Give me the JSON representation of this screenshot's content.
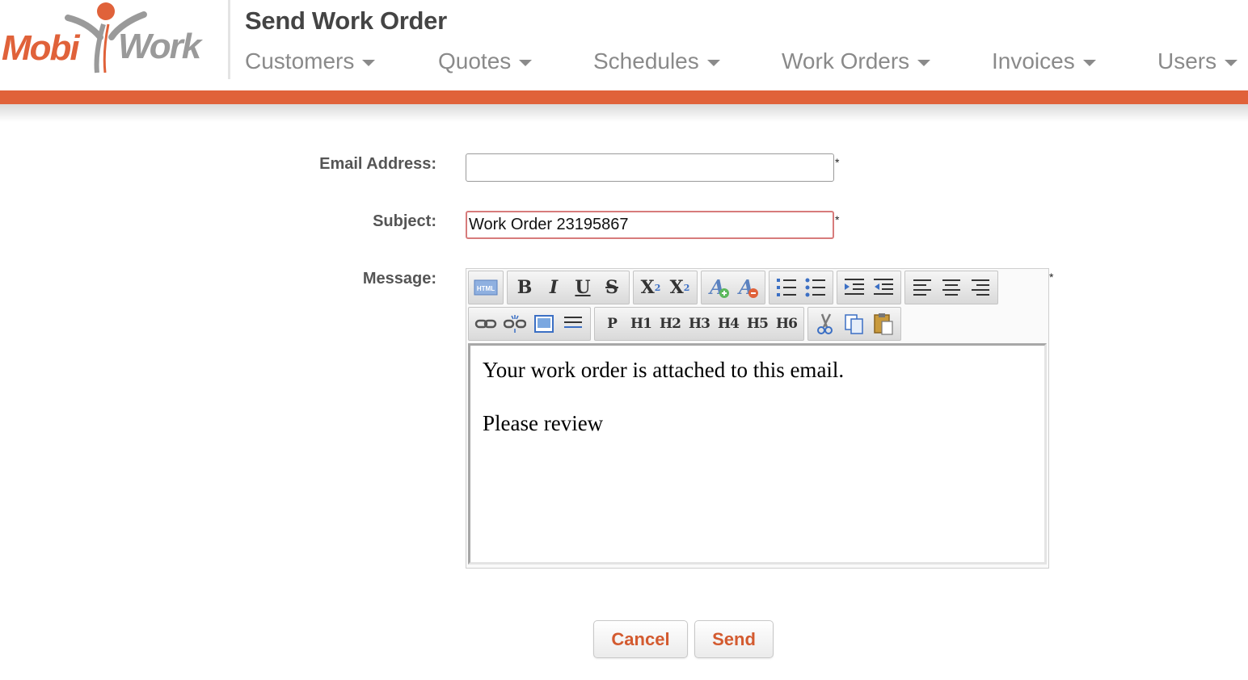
{
  "brand": {
    "logo_text_1": "Mobi",
    "logo_text_2": "Work",
    "accent_color": "#e0623a"
  },
  "header": {
    "title": "Send Work Order"
  },
  "nav": {
    "items": [
      {
        "label": "Customers"
      },
      {
        "label": "Quotes"
      },
      {
        "label": "Schedules"
      },
      {
        "label": "Work Orders"
      },
      {
        "label": "Invoices"
      },
      {
        "label": "Users"
      }
    ]
  },
  "form": {
    "email": {
      "label": "Email Address:",
      "value": "",
      "required_mark": "*"
    },
    "subject": {
      "label": "Subject:",
      "value": "Work Order 23195867",
      "required_mark": "*"
    },
    "message": {
      "label": "Message:",
      "required_mark": "*",
      "lines": [
        "Your work order is attached to this email.",
        "Please review"
      ]
    }
  },
  "toolbar": {
    "html_label": "HTML",
    "bold": "B",
    "italic": "I",
    "underline": "U",
    "strike": "S",
    "subscript": "X",
    "subscript_mark": "2",
    "superscript": "X",
    "superscript_mark": "2",
    "font_color_increase": "A",
    "font_color_decrease": "A",
    "paragraph": "P",
    "h1": "H1",
    "h2": "H2",
    "h3": "H3",
    "h4": "H4",
    "h5": "H5",
    "h6": "H6",
    "icons": [
      "html-icon",
      "bold-icon",
      "italic-icon",
      "underline-icon",
      "strikethrough-icon",
      "subscript-icon",
      "superscript-icon",
      "increase-font-icon",
      "decrease-font-icon",
      "ordered-list-icon",
      "unordered-list-icon",
      "indent-icon",
      "outdent-icon",
      "align-left-icon",
      "align-center-icon",
      "align-right-icon",
      "link-icon",
      "unlink-icon",
      "image-icon",
      "horizontal-rule-icon",
      "cut-icon",
      "copy-icon",
      "paste-icon"
    ]
  },
  "actions": {
    "cancel_label": "Cancel",
    "send_label": "Send"
  }
}
